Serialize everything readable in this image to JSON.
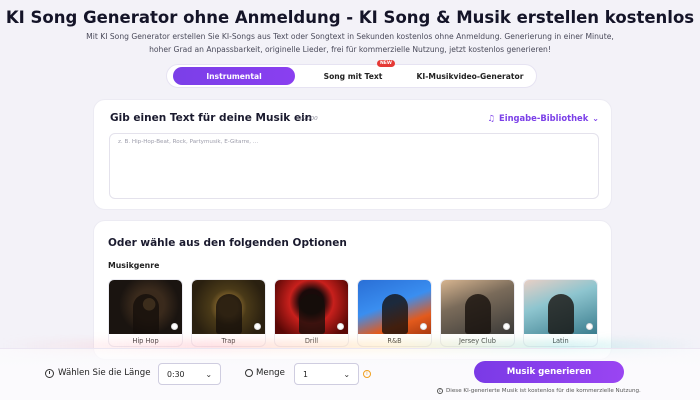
{
  "header": {
    "title": "KI Song Generator ohne Anmeldung - KI Song & Musik erstellen kostenlos",
    "subtitle": "Mit KI Song Generator erstellen Sie KI-Songs aus Text oder Songtext in Sekunden kostenlos ohne Anmeldung. Generierung in einer Minute, hoher Grad an Anpassbarkeit, originelle Lieder, frei für kommerzielle Nutzung, jetzt kostenlos generieren!"
  },
  "tabs": [
    {
      "label": "Instrumental",
      "active": true
    },
    {
      "label": "Song mit Text",
      "badge": "NEW"
    },
    {
      "label": "KI-Musikvideo-Generator"
    }
  ],
  "input_card": {
    "title": "Gib einen Text für deine Musik ein",
    "counter": "0/1000",
    "library_label": "Eingabe-Bibliothek",
    "placeholder": "z. B. Hip-Hop-Beat, Rock, Partymusik, E-Gitarre, ..."
  },
  "options_card": {
    "title": "Oder wähle aus den folgenden Optionen",
    "genre_label": "Musikgenre",
    "genres": [
      {
        "label": "Hip Hop",
        "icon": "hiphop-thumbnail"
      },
      {
        "label": "Trap",
        "icon": "trap-thumbnail"
      },
      {
        "label": "Drill",
        "icon": "drill-thumbnail"
      },
      {
        "label": "R&B",
        "icon": "rnb-thumbnail"
      },
      {
        "label": "Jersey Club",
        "icon": "jersey-club-thumbnail"
      },
      {
        "label": "Latin",
        "icon": "latin-thumbnail"
      }
    ]
  },
  "footer": {
    "length_label": "Wählen Sie die Länge",
    "length_value": "0:30",
    "quantity_label": "Menge",
    "quantity_value": "1",
    "generate_label": "Musik generieren",
    "legal": "Diese KI-generierte Musik ist kostenlos für die kommerzielle Nutzung."
  },
  "colors": {
    "accent": "#7b3fe8",
    "badge": "#e53935",
    "info": "#f0a020"
  }
}
